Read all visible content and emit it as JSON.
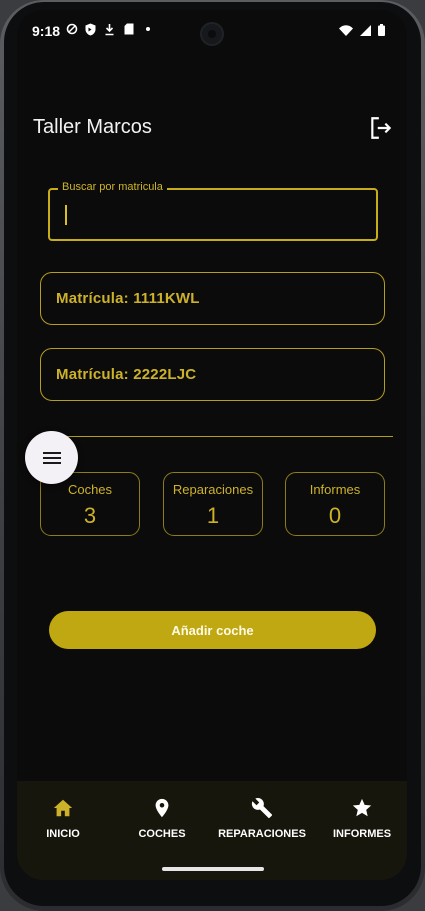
{
  "status_bar": {
    "time": "9:18",
    "left_icons": [
      "vpn-icon",
      "shield-icon",
      "download-icon",
      "sd-card-icon",
      "dot-icon"
    ],
    "right_icons": [
      "wifi-icon",
      "signal-icon",
      "battery-icon"
    ]
  },
  "header": {
    "title": "Taller Marcos",
    "logout_icon": "logout-icon"
  },
  "search": {
    "label": "Buscar por matricula",
    "value": "",
    "placeholder": ""
  },
  "cars": [
    {
      "label": "Matrícula: 1111KWL"
    },
    {
      "label": "Matrícula: 2222LJC"
    }
  ],
  "menu_fab": {
    "icon": "menu-icon"
  },
  "stats": [
    {
      "label": "Coches",
      "value": "3"
    },
    {
      "label": "Reparaciones",
      "value": "1"
    },
    {
      "label": "Informes",
      "value": "0"
    }
  ],
  "add_button": {
    "label": "Añadir coche"
  },
  "bottom_nav": [
    {
      "label": "INICIO",
      "icon": "home-icon",
      "active": true
    },
    {
      "label": "COCHES",
      "icon": "location-pin-icon",
      "active": false
    },
    {
      "label": "REPARACIONES",
      "icon": "wrench-icon",
      "active": false
    },
    {
      "label": "INFORMES",
      "icon": "star-icon",
      "active": false
    }
  ],
  "colors": {
    "accent": "#c7ad18",
    "background": "#0b0b0c",
    "nav_background": "#17160c",
    "active_nav_icon": "#cdb229"
  }
}
